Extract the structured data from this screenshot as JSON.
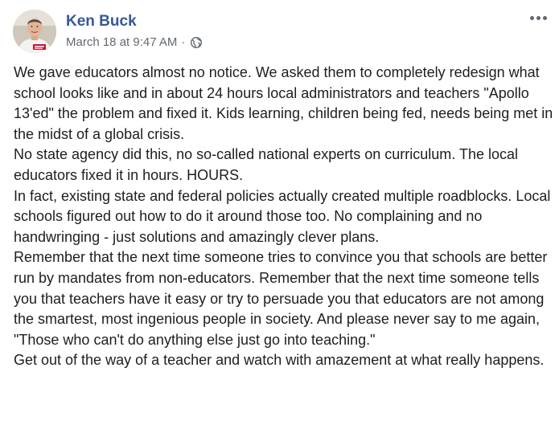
{
  "post": {
    "author": "Ken Buck",
    "timestamp": "March 18 at 9:47 AM",
    "separator": "·",
    "audience_icon": "globe-icon",
    "more_icon": "more-options-icon",
    "paragraphs": [
      "We gave educators almost no notice. We asked them to completely redesign what school looks like and in about 24 hours local administrators and teachers \"Apollo 13'ed\" the problem and fixed it. Kids learning, children being fed, needs being met in the midst of a global crisis.",
      "No state agency did this, no so-called national experts on curriculum. The local educators fixed it in hours. HOURS.",
      "In fact, existing state and federal policies actually created multiple roadblocks. Local schools figured out how to do it around those too. No complaining and no handwringing - just solutions and amazingly clever plans.",
      "Remember that the next time someone tries to convince you that schools are better run by mandates from non-educators. Remember that the next time someone tells you that teachers have it easy or try to persuade you that educators are not among the smartest, most ingenious people in society. And please never say to me again, \"Those who can't do anything else just go into teaching.\"",
      "Get out of the way of a teacher and watch with amazement at what really happens."
    ]
  },
  "colors": {
    "author": "#365899",
    "meta": "#616770",
    "text": "#1c1e21",
    "background": "#ffffff"
  }
}
